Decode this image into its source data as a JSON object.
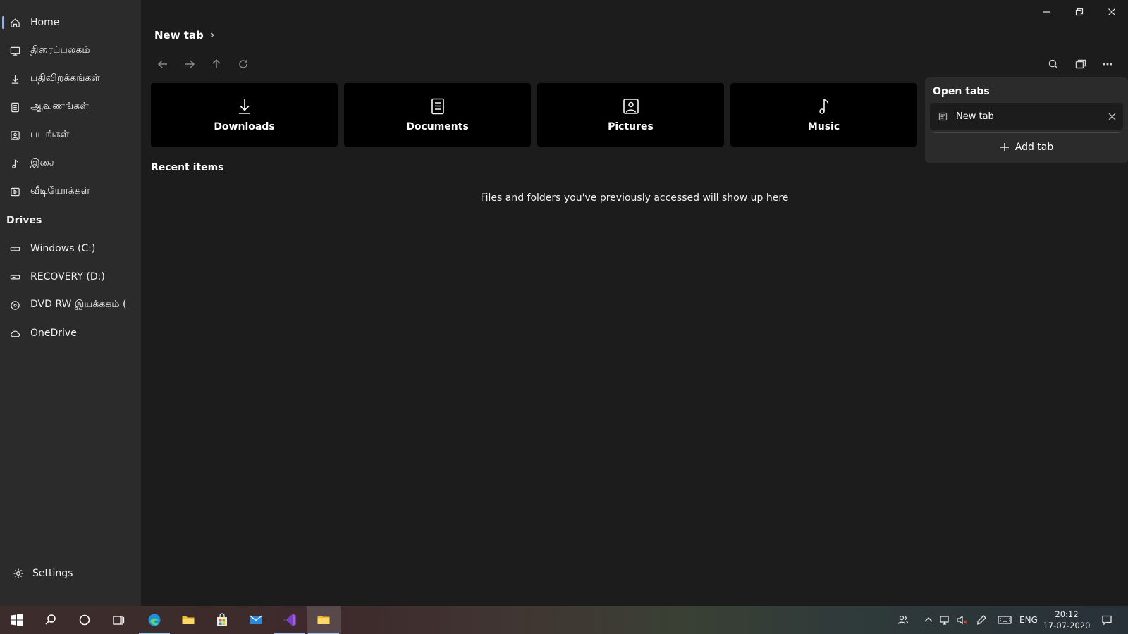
{
  "window": {
    "breadcrumb": "New tab",
    "breadcrumb_chevron": "›"
  },
  "sidebar": {
    "items": [
      {
        "label": "Home",
        "icon": "home-icon"
      },
      {
        "label": "திரைப்பலகம்",
        "icon": "desktop-icon"
      },
      {
        "label": "பதிவிறக்கங்கள்",
        "icon": "download-icon"
      },
      {
        "label": "ஆவணங்கள்",
        "icon": "document-icon"
      },
      {
        "label": "படங்கள்",
        "icon": "picture-icon"
      },
      {
        "label": "இசை",
        "icon": "music-icon"
      },
      {
        "label": "வீடியோக்கள்",
        "icon": "video-icon"
      }
    ],
    "drives_header": "Drives",
    "drives": [
      {
        "label": "Windows (C:)",
        "icon": "drive-icon"
      },
      {
        "label": "RECOVERY (D:)",
        "icon": "drive-icon"
      },
      {
        "label": "DVD RW இயக்ககம் (",
        "icon": "disc-icon"
      },
      {
        "label": "OneDrive",
        "icon": "cloud-icon"
      }
    ],
    "settings_label": "Settings"
  },
  "quick_access": [
    {
      "label": "Downloads",
      "icon": "download-icon"
    },
    {
      "label": "Documents",
      "icon": "document-icon"
    },
    {
      "label": "Pictures",
      "icon": "picture-icon"
    },
    {
      "label": "Music",
      "icon": "music-icon"
    }
  ],
  "recent": {
    "header": "Recent items",
    "empty_message": "Files and folders you've previously accessed will show up here"
  },
  "tabs_flyout": {
    "header": "Open tabs",
    "tabs": [
      {
        "label": "New tab"
      }
    ],
    "add_label": "Add tab"
  },
  "taskbar": {
    "language": "ENG",
    "time": "20:12",
    "date": "17-07-2020"
  },
  "colors": {
    "accent": "#7fb4ff",
    "sidebar_bg": "#2b2b2b",
    "content_bg": "#1c1c1c",
    "card_bg": "#000000"
  }
}
